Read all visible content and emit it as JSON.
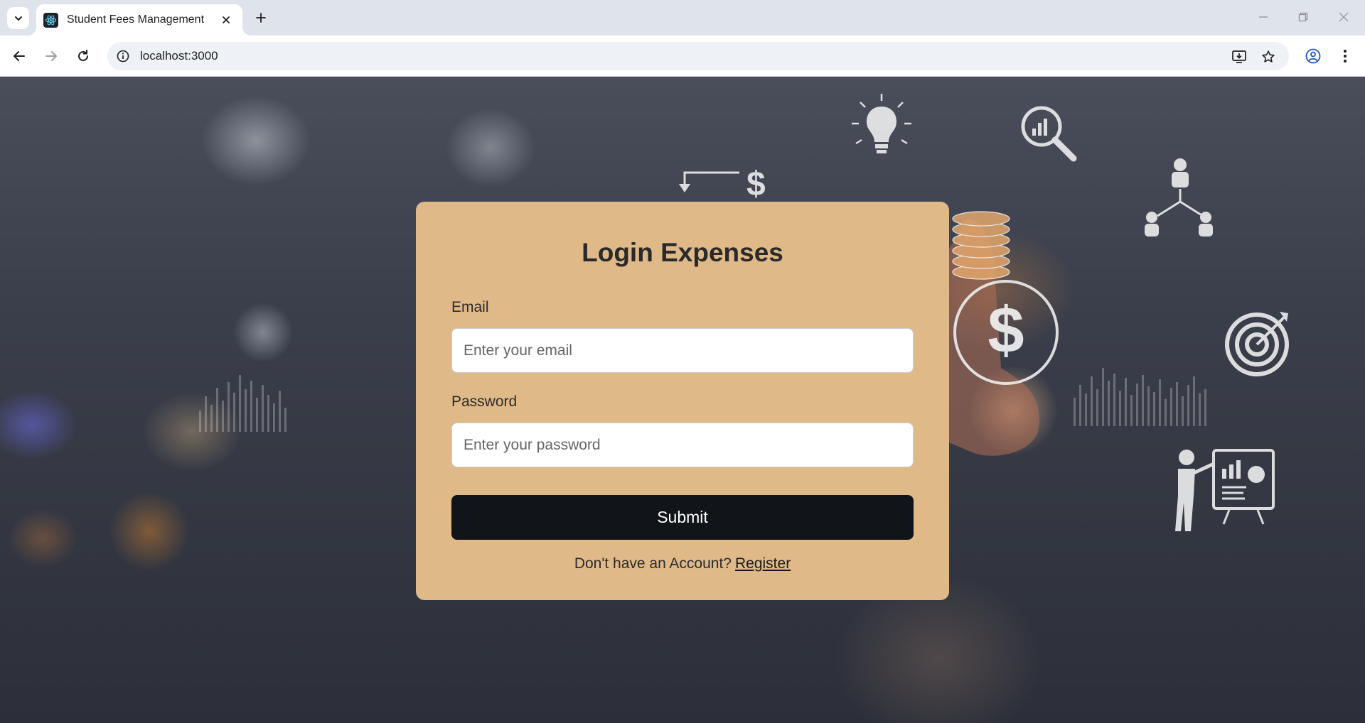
{
  "browser": {
    "tab": {
      "title": "Student Fees Management"
    },
    "address_bar": {
      "url": "localhost:3000"
    }
  },
  "login": {
    "title": "Login Expenses",
    "email": {
      "label": "Email",
      "placeholder": "Enter your email",
      "value": ""
    },
    "password": {
      "label": "Password",
      "placeholder": "Enter your password",
      "value": ""
    },
    "submit_label": "Submit",
    "register_prompt": "Don't have an Account?",
    "register_link": "Register"
  },
  "colors": {
    "card_background": "#dfb988",
    "submit_background": "#111418",
    "tabstrip_background": "#dfe3eb"
  },
  "icons": [
    "chevron-down-icon",
    "react-favicon-icon",
    "close-icon",
    "plus-icon",
    "minimize-icon",
    "restore-icon",
    "back-arrow-icon",
    "forward-arrow-icon",
    "reload-icon",
    "site-info-icon",
    "install-app-icon",
    "bookmark-star-icon",
    "profile-icon",
    "kebab-menu-icon"
  ]
}
